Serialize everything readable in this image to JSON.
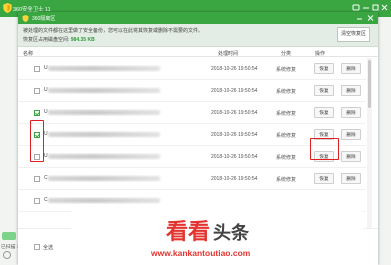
{
  "main_app": {
    "title": "360安全卫士 11",
    "bottom_text": "已扫描 1"
  },
  "dialog": {
    "title": "360隔离区",
    "header": {
      "line1": "被处理的文件都在这里做了安全备份，您可以在此将其恢复或删除不需要的文件。",
      "line2_prefix": "恢复区占用磁盘空间:",
      "line2_size": "984.35 KB",
      "clear_button": "清空恢复区"
    },
    "columns": {
      "name": "名称",
      "time": "处理时间",
      "category": "分类",
      "action": "操作"
    },
    "rows": [
      {
        "letter": "U",
        "time": "2018-10-26 19:50:54",
        "category": "系统修复",
        "restore": "恢复",
        "delete": "删除",
        "checked": false
      },
      {
        "letter": "U",
        "time": "2018-10-26 19:50:54",
        "category": "系统修复",
        "restore": "恢复",
        "delete": "删除",
        "checked": false
      },
      {
        "letter": "U",
        "time": "2018-10-26 19:50:54",
        "category": "系统修复",
        "restore": "恢复",
        "delete": "删除",
        "checked": true
      },
      {
        "letter": "U",
        "time": "2018-10-26 19:50:54",
        "category": "系统修复",
        "restore": "恢复",
        "delete": "删除",
        "checked": true
      },
      {
        "letter": "U",
        "time": "2018-10-26 19:50:54",
        "category": "系统修复",
        "restore": "恢复",
        "delete": "删除",
        "checked": false
      },
      {
        "letter": "C",
        "time": "2018-10-26 19:50:54",
        "category": "系统修复",
        "restore": "恢复",
        "delete": "删除",
        "checked": false
      },
      {
        "letter": "C",
        "time": "",
        "category": "",
        "restore": "",
        "delete": "",
        "checked": false
      }
    ],
    "footer": {
      "select_all": "全选"
    }
  },
  "watermark": {
    "text_cn": "看看头条",
    "text_en": "www.kankantoutiao.com"
  },
  "colors": {
    "brand_green": "#3aa642",
    "highlight_red": "#e02020",
    "watermark_red": "#e3342f"
  },
  "icons": [
    "shield-icon",
    "minimize-icon",
    "close-icon",
    "checkmark-icon"
  ]
}
